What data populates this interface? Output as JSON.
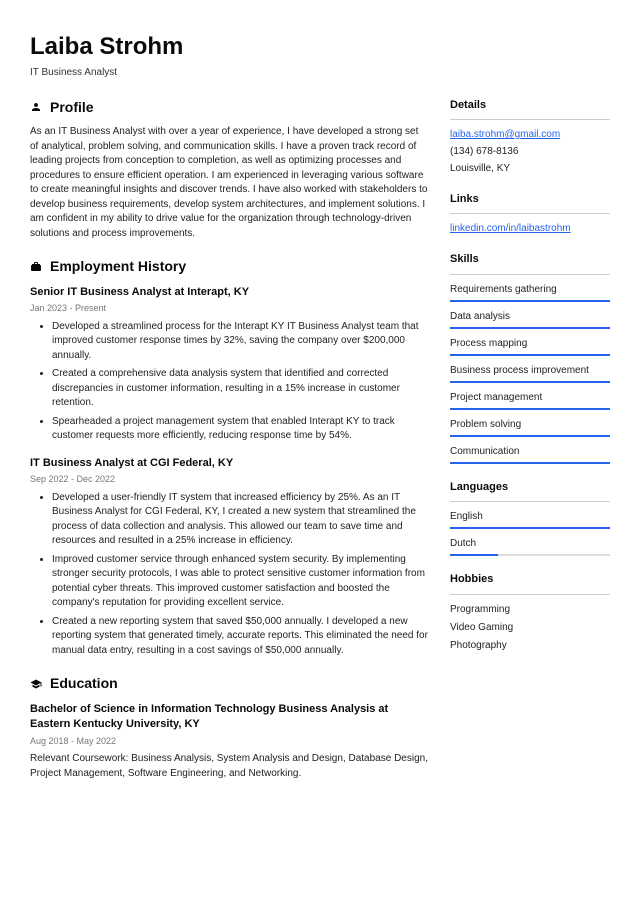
{
  "header": {
    "name": "Laiba Strohm",
    "title": "IT Business Analyst"
  },
  "profile": {
    "heading": "Profile",
    "text": "As an IT Business Analyst with over a year of experience, I have developed a strong set of analytical, problem solving, and communication skills. I have a proven track record of leading projects from conception to completion, as well as optimizing processes and procedures to ensure efficient operation. I am experienced in leveraging various software to create meaningful insights and discover trends. I have also worked with stakeholders to develop business requirements, develop system architectures, and implement solutions. I am confident in my ability to drive value for the organization through technology-driven solutions and process improvements."
  },
  "employment": {
    "heading": "Employment History",
    "jobs": [
      {
        "title": "Senior IT Business Analyst at Interapt, KY",
        "dates": "Jan 2023 - Present",
        "bullets": [
          "Developed a streamlined process for the Interapt KY IT Business Analyst team that improved customer response times by 32%, saving the company over $200,000 annually.",
          "Created a comprehensive data analysis system that identified and corrected discrepancies in customer information, resulting in a 15% increase in customer retention.",
          "Spearheaded a project management system that enabled Interapt KY to track customer requests more efficiently, reducing response time by 54%."
        ]
      },
      {
        "title": "IT Business Analyst at CGI Federal, KY",
        "dates": "Sep 2022 - Dec 2022",
        "bullets": [
          "Developed a user-friendly IT system that increased efficiency by 25%. As an IT Business Analyst for CGI Federal, KY, I created a new system that streamlined the process of data collection and analysis. This allowed our team to save time and resources and resulted in a 25% increase in efficiency.",
          "Improved customer service through enhanced system security. By implementing stronger security protocols, I was able to protect sensitive customer information from potential cyber threats. This improved customer satisfaction and boosted the company's reputation for providing excellent service.",
          "Created a new reporting system that saved $50,000 annually. I developed a new reporting system that generated timely, accurate reports. This eliminated the need for manual data entry, resulting in a cost savings of $50,000 annually."
        ]
      }
    ]
  },
  "education": {
    "heading": "Education",
    "degree": "Bachelor of Science in Information Technology Business Analysis at Eastern Kentucky University, KY",
    "dates": "Aug 2018 - May 2022",
    "desc": "Relevant Coursework: Business Analysis, System Analysis and Design, Database Design, Project Management, Software Engineering, and Networking."
  },
  "details": {
    "heading": "Details",
    "email": "laiba.strohm@gmail.com",
    "phone": "(134) 678-8136",
    "location": "Louisville, KY"
  },
  "links": {
    "heading": "Links",
    "items": [
      "linkedin.com/in/laibastrohm"
    ]
  },
  "skills": {
    "heading": "Skills",
    "items": [
      {
        "name": "Requirements gathering",
        "level": 100
      },
      {
        "name": "Data analysis",
        "level": 100
      },
      {
        "name": "Process mapping",
        "level": 100
      },
      {
        "name": "Business process improvement",
        "level": 100
      },
      {
        "name": "Project management",
        "level": 100
      },
      {
        "name": "Problem solving",
        "level": 100
      },
      {
        "name": "Communication",
        "level": 100
      }
    ]
  },
  "languages": {
    "heading": "Languages",
    "items": [
      {
        "name": "English",
        "level": 100
      },
      {
        "name": "Dutch",
        "level": 30
      }
    ]
  },
  "hobbies": {
    "heading": "Hobbies",
    "items": [
      "Programming",
      "Video Gaming",
      "Photography"
    ]
  }
}
